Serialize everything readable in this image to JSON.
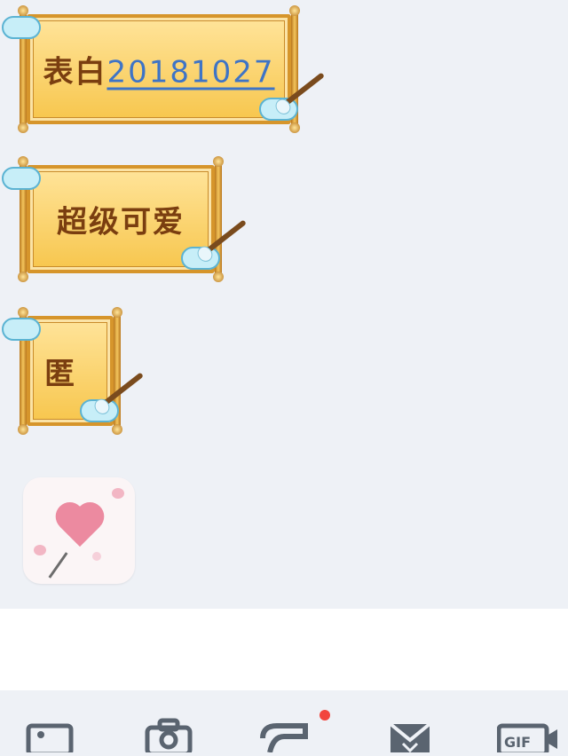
{
  "messages": {
    "scroll_1": {
      "prefix": "表白",
      "date": "20181027"
    },
    "scroll_2": {
      "text": "超级可爱"
    },
    "scroll_3": {
      "text": "匿"
    }
  },
  "sticker": {
    "icon": "heart-balloon-sticker"
  },
  "input": {
    "value": ""
  },
  "toolbar": {
    "tools": [
      {
        "icon": "image-icon"
      },
      {
        "icon": "camera-icon"
      },
      {
        "icon": "red-packet-icon",
        "badge": true
      },
      {
        "icon": "envelope-icon"
      },
      {
        "icon": "gif-icon",
        "label": "GIF"
      }
    ]
  },
  "colors": {
    "background": "#eef1f6",
    "scroll_fill": "#f7c64d",
    "scroll_text": "#7a3e10",
    "date_link": "#3e74c6",
    "badge_red": "#f2453d"
  }
}
